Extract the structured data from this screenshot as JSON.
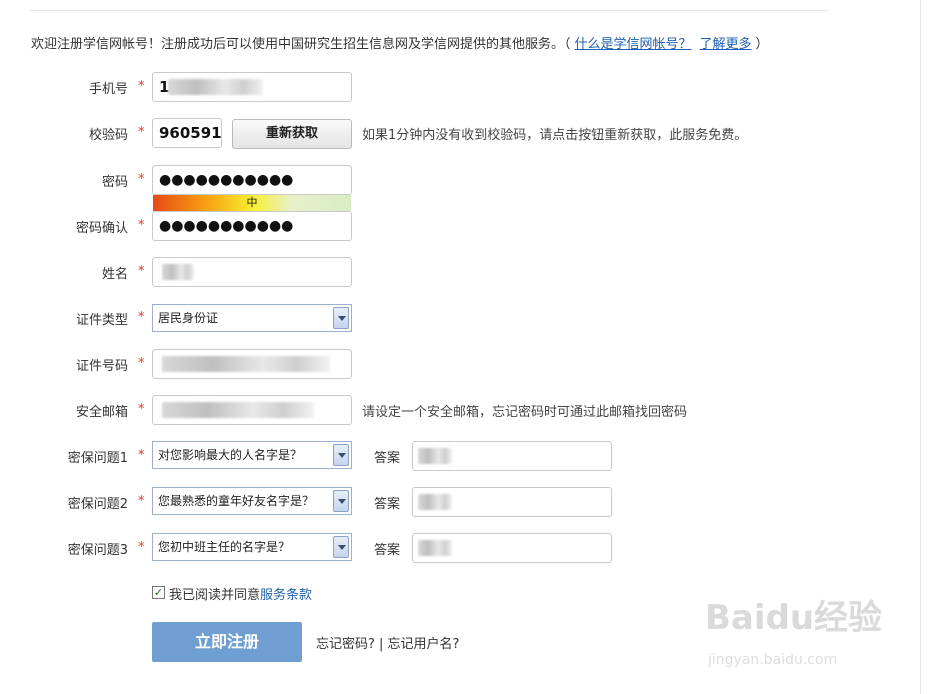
{
  "intro": {
    "text": "欢迎注册学信网帐号！注册成功后可以使用中国研究生招生信息网及学信网提供的其他服务。（",
    "link1": "什么是学信网帐号？",
    "link2": "了解更多",
    "close_paren": "）"
  },
  "fields": {
    "phone": {
      "label": "手机号",
      "value": "1"
    },
    "code": {
      "label": "校验码",
      "value": "960591",
      "resend": "重新获取",
      "hint": "如果1分钟内没有收到校验码，请点击按钮重新获取，此服务免费。"
    },
    "password": {
      "label": "密码",
      "value": "●●●●●●●●●●●",
      "strength": "中"
    },
    "password_confirm": {
      "label": "密码确认",
      "value": "●●●●●●●●●●●"
    },
    "name": {
      "label": "姓名"
    },
    "id_type": {
      "label": "证件类型",
      "value": "居民身份证"
    },
    "id_number": {
      "label": "证件号码"
    },
    "email": {
      "label": "安全邮箱",
      "hint": "请设定一个安全邮箱，忘记密码时可通过此邮箱找回密码"
    },
    "q1": {
      "label": "密保问题1",
      "value": "对您影响最大的人名字是？",
      "answer_label": "答案"
    },
    "q2": {
      "label": "密保问题2",
      "value": "您最熟悉的童年好友名字是？",
      "answer_label": "答案"
    },
    "q3": {
      "label": "密保问题3",
      "value": "您初中班主任的名字是？",
      "answer_label": "答案"
    }
  },
  "required_mark": "*",
  "agree": {
    "text": "我已阅读并同意",
    "link": "服务条款",
    "checked_mark": "✓"
  },
  "submit": "立即注册",
  "forgot": "忘记密码? | 忘记用户名?",
  "watermark": {
    "logo": "Baidu经验",
    "url": "jingyan.baidu.com"
  }
}
